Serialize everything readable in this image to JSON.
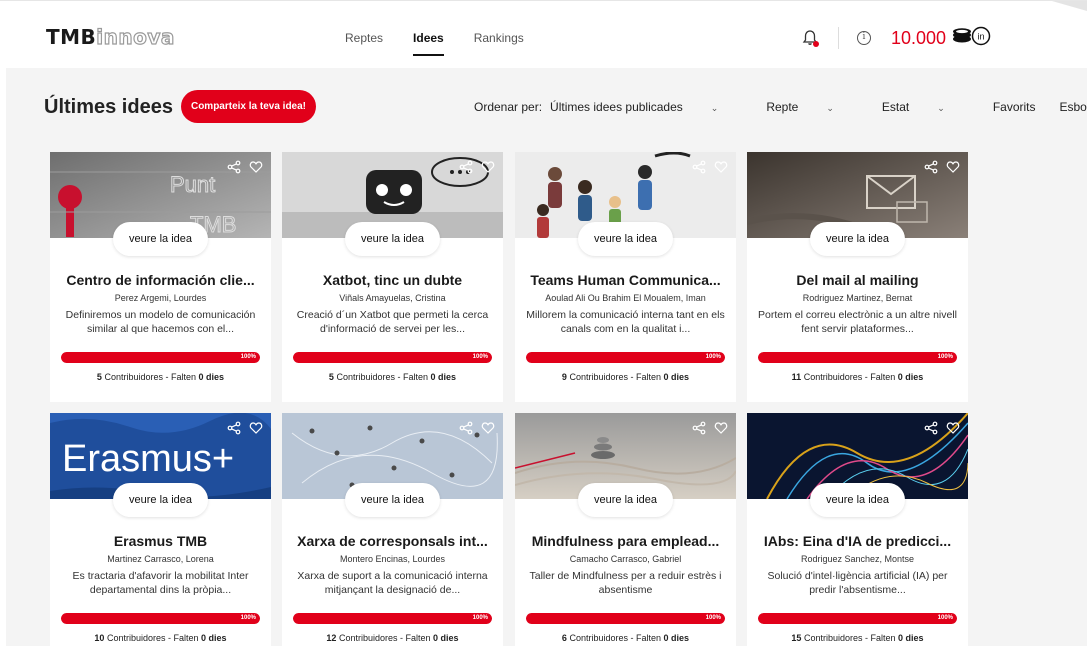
{
  "header": {
    "logo_a": "TMB",
    "logo_b": "innova",
    "nav": [
      {
        "label": "Reptes"
      },
      {
        "label": "Idees"
      },
      {
        "label": "Rankings"
      }
    ],
    "points": "10.000"
  },
  "page": {
    "title": "Últimes idees",
    "share_button": "Comparteix la teva idea!",
    "sort_label": "Ordenar per:",
    "sort_value": "Últimes idees publicades",
    "filter_repte": "Repte",
    "filter_estat": "Estat",
    "favorits": "Favorits",
    "esborranys": "Esborranys"
  },
  "card_common": {
    "veure": "veure la idea",
    "contrib_suffix": "Contribuidores - Falten",
    "days_suffix": "dies"
  },
  "cards": [
    {
      "title": "Centro de información clie...",
      "author": "Perez Argemi, Lourdes",
      "desc": "Definiremos un modelo de comunicación similar al que hacemos con el...",
      "progress": 100,
      "progress_label": "100%",
      "contributors": "5",
      "days": "0"
    },
    {
      "title": "Xatbot, tinc un dubte",
      "author": "Viñals Amayuelas, Cristina",
      "desc": "Creació d´un Xatbot que permeti la cerca d'informació de servei per les...",
      "progress": 100,
      "progress_label": "100%",
      "contributors": "5",
      "days": "0"
    },
    {
      "title": "Teams Human Communica...",
      "author": "Aoulad Ali Ou Brahim El Moualem, Iman",
      "desc": "Millorem la comunicació interna tant en els canals com en la qualitat i...",
      "progress": 100,
      "progress_label": "100%",
      "contributors": "9",
      "days": "0"
    },
    {
      "title": "Del mail al mailing",
      "author": "Rodriguez Martinez, Bernat",
      "desc": "Portem el correu electrònic a un altre nivell fent servir plataformes...",
      "progress": 100,
      "progress_label": "100%",
      "contributors": "11",
      "days": "0"
    },
    {
      "title": "Erasmus TMB",
      "author": "Martinez Carrasco, Lorena",
      "desc": "Es tractaria d'afavorir la mobilitat Inter departamental dins la pròpia...",
      "progress": 100,
      "progress_label": "100%",
      "contributors": "10",
      "days": "0",
      "img_text": "Erasmus+"
    },
    {
      "title": "Xarxa de corresponsals int...",
      "author": "Montero Encinas, Lourdes",
      "desc": "Xarxa de suport a la comunicació interna mitjançant la designació de...",
      "progress": 100,
      "progress_label": "100%",
      "contributors": "12",
      "days": "0"
    },
    {
      "title": "Mindfulness para emplead...",
      "author": "Camacho Carrasco, Gabriel",
      "desc": "Taller de Mindfulness per a reduir estrès i absentisme",
      "progress": 100,
      "progress_label": "100%",
      "contributors": "6",
      "days": "0"
    },
    {
      "title": "IAbs: Eina d'IA de predicci...",
      "author": "Rodriguez Sanchez, Montse",
      "desc": "Solució d'intel·ligència artificial (IA) per predir l'absentisme...",
      "progress": 100,
      "progress_label": "100%",
      "contributors": "15",
      "days": "0"
    }
  ],
  "colors": {
    "accent": "#e1001a"
  }
}
